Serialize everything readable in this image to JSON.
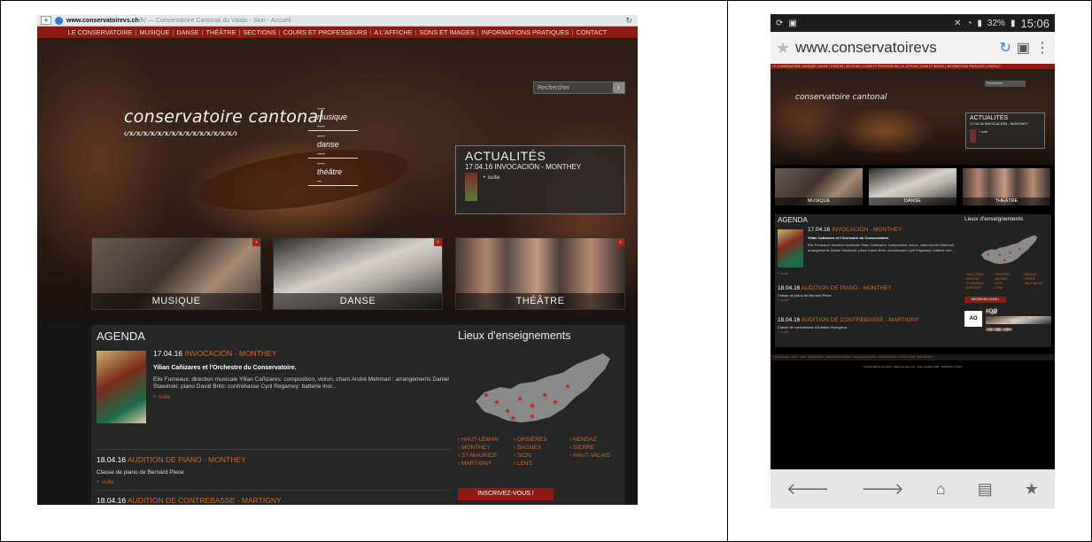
{
  "desktop": {
    "url_domain": "www.conservatoirevs.ch",
    "url_path": "/fr/",
    "page_title": "— Conservatoire Cantonal du Valais - Sion - Accueil",
    "nav": [
      "LE CONSERVATOIRE",
      "MUSIQUE",
      "DANSE",
      "THÉÂTRE",
      "SECTIONS",
      "COURS ET PROFESSEURS",
      "A L'AFFICHE",
      "SONS ET IMAGES",
      "INFORMATIONS PRATIQUES",
      "CONTACT"
    ],
    "search_placeholder": "Rechercher",
    "logo_main": "conservatoire cantonal",
    "logo_sub": [
      "— musique —",
      "— danse —",
      "— théâtre –"
    ],
    "logo_waves": "ᔕᔕᔕᔕᔕᔕᔕᔕᔕᔕᔕᔕᔕᔕᔕᔕ",
    "news_heading": "ACTUALITÉS",
    "news_item": "17.04.16 INVOCACIÓN - MONTHEY",
    "news_more": "‣ suite",
    "tiles": [
      "MUSIQUE",
      "DANSE",
      "THÉÂTRE"
    ],
    "agenda_heading": "AGENDA",
    "event1": {
      "date": "17.04.16",
      "title": "INVOCACIÓN - MONTHEY",
      "subtitle": "Yilian Cañizares et l'Orchestre du Conservatoire.",
      "body": "Elie Fumeaux: direction musicale Yilian Cañizares: composition, violon, chant André Mehmari : arrangements Daniel Stawinski: piano David Brito: contrebasse Cyril Regamey: batterie Inor...",
      "more": "‣ suite"
    },
    "event2": {
      "date": "18.04.16",
      "title": "AUDITION DE PIANO - MONTHEY",
      "subtitle": "Classe de piano de Bernard Piece",
      "more": "‣ suite"
    },
    "event3": {
      "date": "18.04.16",
      "title": "AUDITION DE CONTREBASSE - MARTIGNY"
    },
    "lieux_heading": "Lieux d'enseignements",
    "places": [
      "› HAUT-LÉMAN",
      "› ORSIÈRES",
      "› NENDAZ",
      "› MONTHEY",
      "› BAGNES",
      "› SIERRE",
      "› ST-MAURICE",
      "› SION",
      "› HAUT-VALAIS",
      "› MARTIGNY",
      "› LENS"
    ],
    "inscription": "INSCRIVEZ-VOUS !"
  },
  "mobile": {
    "status_battery": "32%",
    "status_time": "15:06",
    "url": "www.conservatoirevs",
    "nav_text": "LE CONSERVATOIRE | MUSIQUE | DANSE | THÉÂTRE | SECTIONS | COURS ET PROFESSEURS | A L'AFFICHE | SONS ET IMAGES | INFORMATIONS PRATIQUES | CONTACT",
    "search_placeholder": "Rechercher",
    "logo_main": "conservatoire cantonal",
    "news_heading": "ACTUALITÉS",
    "news_item": "17.04.16 INVOCACIÓN - MONTHEY",
    "news_more": "‣ suite",
    "tiles": [
      "MUSIQUE",
      "DANSE",
      "THÉÂTRE"
    ],
    "agenda_heading": "AGENDA",
    "event1": {
      "date": "17.04.16",
      "title": "INVOCACIÓN - MONTHEY",
      "subtitle": "Yilian Cañizares et l'Orchestre du Conservatoire.",
      "body": "Elie Fumeaux: direction musicale Yilian Cañizares: composition, violon, chant André Mehmari : arrangements Daniel Stawinski: piano David Brito: contrebasse Cyril Regamey: batterie Inor...",
      "more": "‣ suite"
    },
    "event2": {
      "date": "18.04.16",
      "title": "AUDITION DE PIANO - MONTHEY",
      "subtitle": "Classe de piano de Bernard Piece",
      "more": "‣ suite"
    },
    "event3": {
      "date": "18.04.16",
      "title": "AUDITION DE CONTREBASSE - MARTIGNY",
      "subtitle": "Classe de contrebasse d'Adriana Georgieva",
      "more": "‣ suite"
    },
    "lieux_heading": "Lieux d'enseignements",
    "places": [
      "› HAUT-LÉMAN",
      "› ORSIÈRES",
      "› NENDAZ",
      "› MONTHEY",
      "› BAGNES",
      "› SIERRE",
      "› ST-MAURICE",
      "› SION",
      "› HAUT-VALAIS",
      "› MARTIGNY",
      "› LENS"
    ],
    "inscription": "INSCRIVEZ-VOUS !",
    "ado_title": "ADO",
    "ado_sub": "AMIS DES ORCHESTRES DU CONSERVATOIRE",
    "ado_link": "Visitez le site de l'ADO",
    "footer_links": "RECHERCHE · LIENS · JOBS · PARTENAIRES · ESPACE PROFESSEUR · ESPACE ETUDIANTS · ESPACE PRESSE · PLAN DU SITE · NEWSLETTER",
    "footer_address": "Conservatoire Cantonal · Place du Scex 10 · Case postale 2109 · 1950 Sion 2 Nord"
  }
}
